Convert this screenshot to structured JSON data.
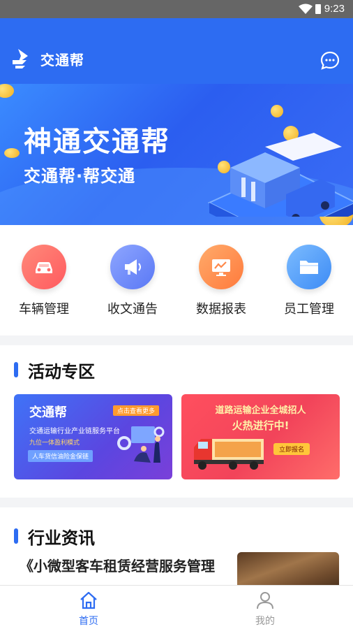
{
  "status_bar": {
    "time": "9:23"
  },
  "header": {
    "app_name": "交通帮"
  },
  "banner": {
    "title": "神通交通帮",
    "subtitle": "交通帮·帮交通"
  },
  "quick_actions": [
    {
      "label": "车辆管理",
      "icon": "car-icon",
      "color": "#ff6b6b"
    },
    {
      "label": "收文通告",
      "icon": "megaphone-icon",
      "color": "#6a8bff"
    },
    {
      "label": "数据报表",
      "icon": "chart-monitor-icon",
      "color": "#ff8a4c"
    },
    {
      "label": "员工管理",
      "icon": "folder-icon",
      "color": "#4d9bff"
    }
  ],
  "activity": {
    "section_title": "活动专区",
    "card1": {
      "brand": "交通帮",
      "tag": "点击查看更多",
      "line1": "交通运输行业产业链服务平台",
      "line2": "九位一体盈利模式",
      "pill": "人车货信油险金保链"
    },
    "card2": {
      "headline": "道路运输企业全城招人",
      "headline2": "火热进行中!",
      "button": "立即报名"
    }
  },
  "news": {
    "section_title": "行业资讯",
    "first_item_title": "《小微型客车租赁经营服务管理"
  },
  "tabbar": [
    {
      "label": "首页",
      "icon": "home-icon",
      "active": true
    },
    {
      "label": "我的",
      "icon": "user-icon",
      "active": false
    }
  ],
  "colors": {
    "primary": "#2d6cf2",
    "tab_inactive": "#999999"
  }
}
